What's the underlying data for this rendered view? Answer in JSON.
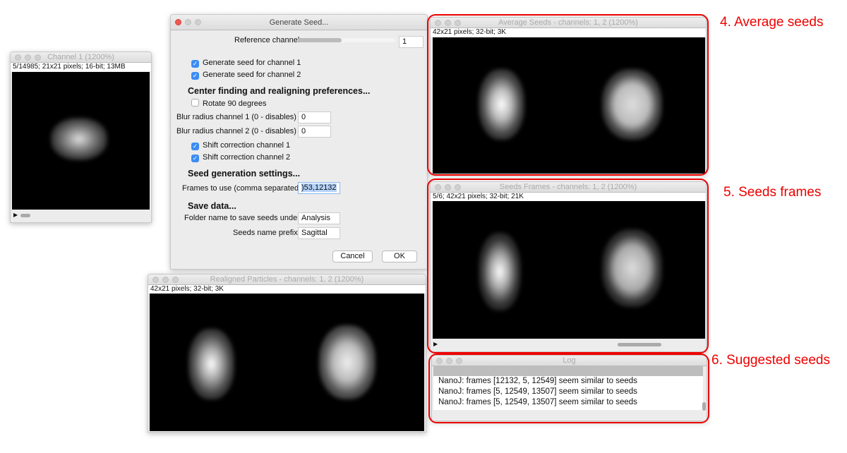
{
  "channel1": {
    "title": "Channel 1 (1200%)",
    "info": "5/14985; 21x21 pixels; 16-bit; 13MB"
  },
  "dialog": {
    "title": "Generate Seed...",
    "reference_label": "Reference channel",
    "reference_value": "1",
    "reference_slider": 0.45,
    "gen1": "Generate seed for channel 1",
    "gen2": "Generate seed for channel 2",
    "h_center": "Center finding and realigning preferences...",
    "rotate": "Rotate 90 degrees",
    "blur1_label": "Blur radius channel 1 (0 - disables)",
    "blur1": "0",
    "blur2_label": "Blur radius channel 2 (0 - disables)",
    "blur2": "0",
    "shift1": "Shift correction channel 1",
    "shift2": "Shift correction channel 2",
    "h_seed": "Seed generation settings...",
    "frames_label": "Frames to use (comma separated)",
    "frames": ")53,12132",
    "h_save": "Save data...",
    "folder_label": "Folder name to save seeds under",
    "folder": "Analysis",
    "prefix_label": "Seeds name prefix",
    "prefix": "Sagittal",
    "cancel": "Cancel",
    "ok": "OK",
    "check": "✓"
  },
  "realigned": {
    "title": "Realigned Particles - channels: 1, 2 (1200%)",
    "info": "42x21 pixels; 32-bit; 3K"
  },
  "average": {
    "title": "Average Seeds - channels: 1, 2 (1200%)",
    "info": "42x21 pixels; 32-bit; 3K"
  },
  "frames": {
    "title": "Seeds Frames - channels: 1, 2 (1200%)",
    "info": "5/6; 42x21 pixels; 32-bit; 21K"
  },
  "log": {
    "title": "Log",
    "lines": [
      "NanoJ: frames [12132, 5, 12549] seem similar to seeds",
      "NanoJ: frames [5, 12549, 13507] seem similar to seeds",
      "NanoJ: frames [5, 12549, 13507] seem similar to seeds"
    ]
  },
  "annotations": {
    "a4": "4. Average seeds",
    "a5": "5. Seeds frames",
    "a6": "6. Suggested seeds"
  },
  "colors": {
    "highlight": "#ee0000",
    "checkbox": "#3b8cf5"
  }
}
